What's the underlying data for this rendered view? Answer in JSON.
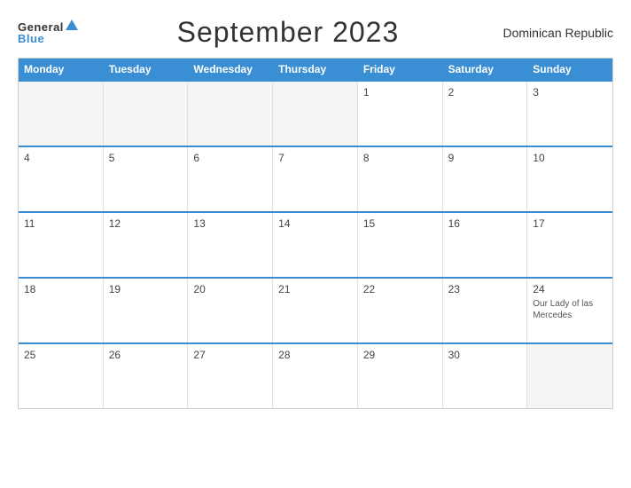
{
  "header": {
    "logo_general": "General",
    "logo_blue": "Blue",
    "title": "September 2023",
    "country": "Dominican Republic"
  },
  "days": [
    "Monday",
    "Tuesday",
    "Wednesday",
    "Thursday",
    "Friday",
    "Saturday",
    "Sunday"
  ],
  "weeks": [
    [
      {
        "num": "",
        "holiday": ""
      },
      {
        "num": "",
        "holiday": ""
      },
      {
        "num": "",
        "holiday": ""
      },
      {
        "num": "",
        "holiday": ""
      },
      {
        "num": "1",
        "holiday": ""
      },
      {
        "num": "2",
        "holiday": ""
      },
      {
        "num": "3",
        "holiday": ""
      }
    ],
    [
      {
        "num": "4",
        "holiday": ""
      },
      {
        "num": "5",
        "holiday": ""
      },
      {
        "num": "6",
        "holiday": ""
      },
      {
        "num": "7",
        "holiday": ""
      },
      {
        "num": "8",
        "holiday": ""
      },
      {
        "num": "9",
        "holiday": ""
      },
      {
        "num": "10",
        "holiday": ""
      }
    ],
    [
      {
        "num": "11",
        "holiday": ""
      },
      {
        "num": "12",
        "holiday": ""
      },
      {
        "num": "13",
        "holiday": ""
      },
      {
        "num": "14",
        "holiday": ""
      },
      {
        "num": "15",
        "holiday": ""
      },
      {
        "num": "16",
        "holiday": ""
      },
      {
        "num": "17",
        "holiday": ""
      }
    ],
    [
      {
        "num": "18",
        "holiday": ""
      },
      {
        "num": "19",
        "holiday": ""
      },
      {
        "num": "20",
        "holiday": ""
      },
      {
        "num": "21",
        "holiday": ""
      },
      {
        "num": "22",
        "holiday": ""
      },
      {
        "num": "23",
        "holiday": ""
      },
      {
        "num": "24",
        "holiday": "Our Lady of las Mercedes"
      }
    ],
    [
      {
        "num": "25",
        "holiday": ""
      },
      {
        "num": "26",
        "holiday": ""
      },
      {
        "num": "27",
        "holiday": ""
      },
      {
        "num": "28",
        "holiday": ""
      },
      {
        "num": "29",
        "holiday": ""
      },
      {
        "num": "30",
        "holiday": ""
      },
      {
        "num": "",
        "holiday": ""
      }
    ]
  ]
}
